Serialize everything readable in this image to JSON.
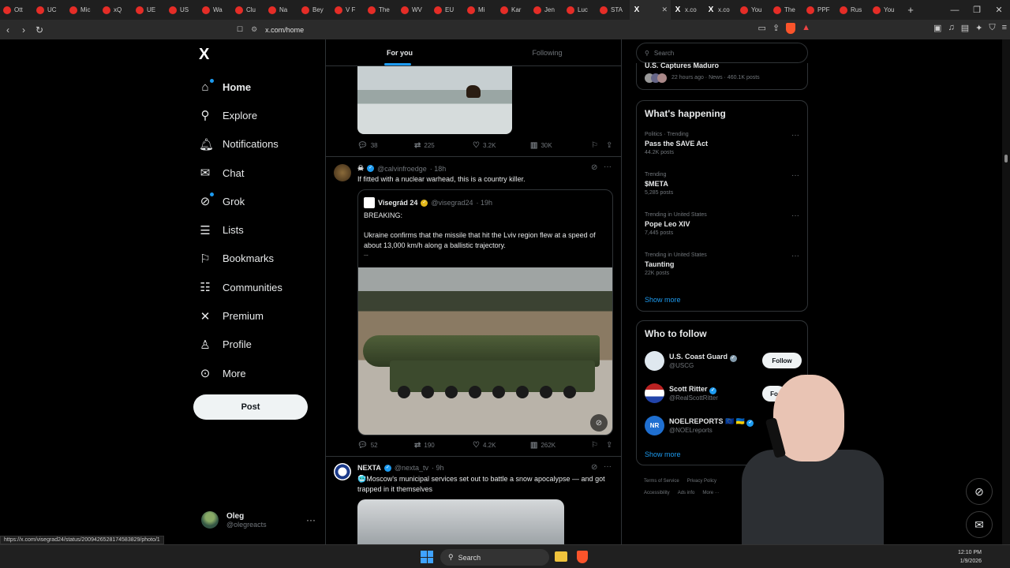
{
  "browser": {
    "tabs": [
      "Ott",
      "UC",
      "Mic",
      "xQ",
      "UE",
      "US",
      "Wa",
      "Clu",
      "Na",
      "Bey",
      "V F",
      "The",
      "WV",
      "EU",
      "Mi",
      "Kar",
      "Jen",
      "Luc",
      "STA",
      "",
      "x.co",
      "x.co",
      "You",
      "The",
      "PPF",
      "Rus",
      "You"
    ],
    "active_tab_index": 19,
    "url": "x.com/home",
    "status_url": "https://x.com/visegrad24/status/2009426528174583829/photo/1"
  },
  "sidebar": {
    "logo": "X",
    "items": [
      {
        "label": "Home",
        "icon": "home-icon"
      },
      {
        "label": "Explore",
        "icon": "search-icon"
      },
      {
        "label": "Notifications",
        "icon": "bell-icon"
      },
      {
        "label": "Chat",
        "icon": "mail-icon"
      },
      {
        "label": "Grok",
        "icon": "grok-icon"
      },
      {
        "label": "Lists",
        "icon": "list-icon"
      },
      {
        "label": "Bookmarks",
        "icon": "bookmark-icon"
      },
      {
        "label": "Communities",
        "icon": "communities-icon"
      },
      {
        "label": "Premium",
        "icon": "x-icon"
      },
      {
        "label": "Profile",
        "icon": "person-icon"
      },
      {
        "label": "More",
        "icon": "more-circle-icon"
      }
    ],
    "post_label": "Post",
    "account": {
      "name": "Oleg",
      "handle": "@olegreacts"
    }
  },
  "feed": {
    "tabs": [
      "For you",
      "Following"
    ],
    "post1": {
      "replies": "38",
      "reposts": "225",
      "likes": "3.2K",
      "views": "30K"
    },
    "post2": {
      "name": "☠ ",
      "handle": "@calvinfroedge",
      "time": "· 18h",
      "text": "If fitted with a nuclear warhead, this is a country killer.",
      "quote": {
        "name": "Visegrád 24",
        "handle": "@visegrad24",
        "time": "· 19h",
        "line1": "BREAKING:",
        "line2": "Ukraine confirms that the missile that hit the Lviv region flew at a speed of about 13,000 km/h along a ballistic trajectory.",
        "line3": "..."
      },
      "replies": "52",
      "reposts": "190",
      "likes": "4.2K",
      "views": "262K"
    },
    "post3": {
      "name": "NEXTA",
      "handle": "@nexta_tv",
      "time": "· 9h",
      "text": "🥶Moscow's municipal services set out to battle a snow apocalypse — and got trapped in it themselves"
    }
  },
  "right": {
    "search_placeholder": "Search",
    "top_story": {
      "title": "U.S. Captures Maduro",
      "meta": "22 hours ago · News · 460.1K posts"
    },
    "happening_title": "What's happening",
    "trends": [
      {
        "context": "Politics · Trending",
        "name": "Pass the SAVE Act",
        "posts": "44.2K posts"
      },
      {
        "context": "Trending",
        "name": "$META",
        "posts": "5,285 posts"
      },
      {
        "context": "Trending in United States",
        "name": "Pope Leo XIV",
        "posts": "7,445 posts"
      },
      {
        "context": "Trending in United States",
        "name": "Taunting",
        "posts": "22K posts"
      }
    ],
    "show_more": "Show more",
    "wtf_title": "Who to follow",
    "follow_label": "Follow",
    "follow_short": "Fo",
    "accounts": [
      {
        "name": "U.S. Coast Guard",
        "handle": "@USCG",
        "flags": ""
      },
      {
        "name": "Scott Ritter",
        "handle": "@RealScottRitter",
        "flags": ""
      },
      {
        "name": "NOELREPORTS",
        "handle": "@NOELreports",
        "flags": "🇪🇺 🇺🇦"
      }
    ],
    "footer": [
      "Terms of Service",
      "Privacy Policy",
      "Accessibility",
      "Ads info",
      "More ···"
    ]
  },
  "taskbar": {
    "search": "Search",
    "time": "12:10 PM",
    "date": "1/9/2026"
  },
  "colors": {
    "accent": "#1d9bf0",
    "brave": "#fb542b"
  }
}
